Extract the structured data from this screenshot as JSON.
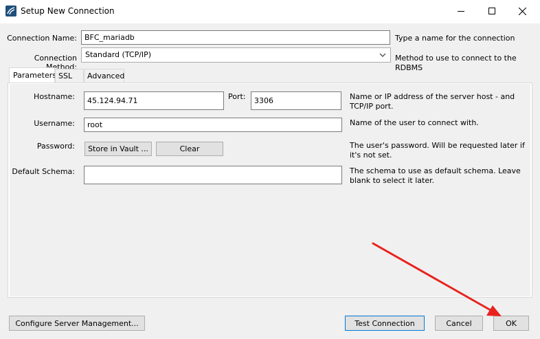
{
  "window": {
    "title": "Setup New Connection",
    "minimize_icon": "minimize-icon",
    "maximize_icon": "maximize-icon",
    "close_icon": "close-icon"
  },
  "connection_name": {
    "label": "Connection Name:",
    "value": "BFC_mariadb",
    "hint": "Type a name for the connection"
  },
  "connection_method": {
    "label": "Connection Method:",
    "value": "Standard (TCP/IP)",
    "hint": "Method to use to connect to the RDBMS"
  },
  "tabs": [
    {
      "label": "Parameters",
      "active": true
    },
    {
      "label": "SSL",
      "active": false
    },
    {
      "label": "Advanced",
      "active": false
    }
  ],
  "parameters": {
    "hostname": {
      "label": "Hostname:",
      "value": "45.124.94.71"
    },
    "port": {
      "label": "Port:",
      "value": "3306"
    },
    "host_hint": "Name or IP address of the server host - and TCP/IP port.",
    "username": {
      "label": "Username:",
      "value": "root",
      "hint": "Name of the user to connect with."
    },
    "password": {
      "label": "Password:",
      "store_button": "Store in Vault ...",
      "clear_button": "Clear",
      "hint": "The user's password. Will be requested later if it's not set."
    },
    "default_schema": {
      "label": "Default Schema:",
      "value": "",
      "hint": "The schema to use as default schema. Leave blank to select it later."
    }
  },
  "footer": {
    "configure_button": "Configure Server Management...",
    "test_button": "Test Connection",
    "cancel_button": "Cancel",
    "ok_button": "OK"
  },
  "colors": {
    "annotation_arrow": "#e8231f",
    "focus_border": "#0078d7"
  }
}
